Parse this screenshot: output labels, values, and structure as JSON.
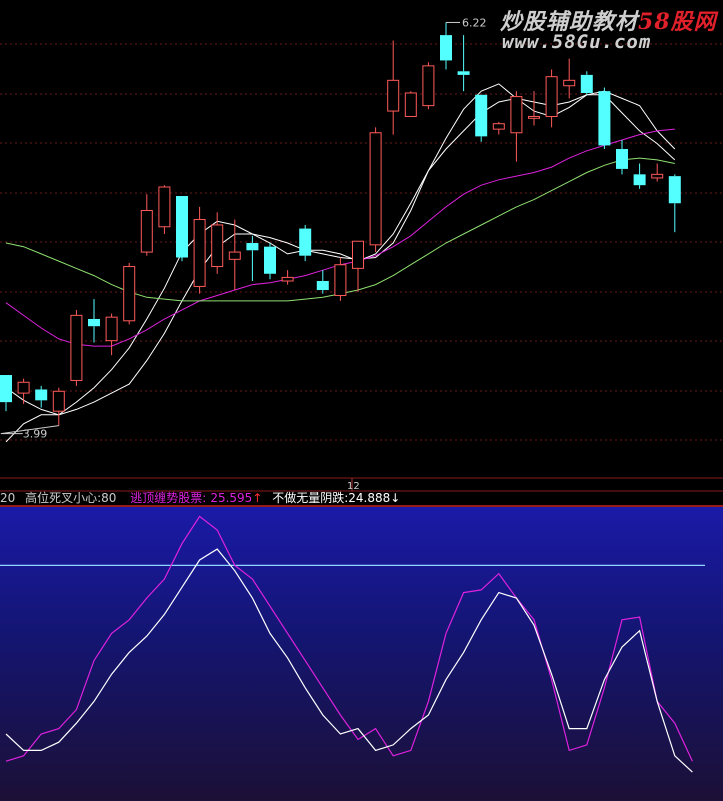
{
  "watermark": {
    "line1_a": "炒股辅助教材",
    "line1_b": "58股网",
    "line2": "www.58Gu.com"
  },
  "indicator_header": {
    "prefix": "20",
    "item1": "高位死叉小心:80",
    "item2_label": "逃顶缠势股票:",
    "item2_value": "25.595",
    "item2_arrow": "↑",
    "item3_label": "不做无量阴跌:",
    "item3_value": "24.888",
    "item3_arrow": "↓"
  },
  "chart_data": [
    {
      "type": "candlestick",
      "title": "",
      "high_label": "6.22",
      "low_label": "3.99",
      "x_tick_label": "12",
      "up_color": "#ff5a5a",
      "down_color": "#54ffff",
      "ylim": [
        3.8,
        6.3
      ],
      "candles": [
        {
          "o": 4.27,
          "h": 4.27,
          "l": 4.07,
          "c": 4.12
        },
        {
          "o": 4.17,
          "h": 4.25,
          "l": 4.11,
          "c": 4.23
        },
        {
          "o": 4.19,
          "h": 4.21,
          "l": 4.09,
          "c": 4.13
        },
        {
          "o": 4.07,
          "h": 4.2,
          "l": 3.99,
          "c": 4.18
        },
        {
          "o": 4.24,
          "h": 4.63,
          "l": 4.21,
          "c": 4.6
        },
        {
          "o": 4.58,
          "h": 4.69,
          "l": 4.45,
          "c": 4.54
        },
        {
          "o": 4.46,
          "h": 4.61,
          "l": 4.38,
          "c": 4.59
        },
        {
          "o": 4.57,
          "h": 4.89,
          "l": 4.55,
          "c": 4.87
        },
        {
          "o": 4.95,
          "h": 5.27,
          "l": 4.93,
          "c": 5.18
        },
        {
          "o": 5.09,
          "h": 5.32,
          "l": 5.05,
          "c": 5.31
        },
        {
          "o": 5.26,
          "h": 5.26,
          "l": 4.9,
          "c": 4.92
        },
        {
          "o": 4.76,
          "h": 5.2,
          "l": 4.72,
          "c": 5.13
        },
        {
          "o": 4.87,
          "h": 5.17,
          "l": 4.83,
          "c": 5.1
        },
        {
          "o": 4.91,
          "h": 5.13,
          "l": 4.74,
          "c": 4.95
        },
        {
          "o": 5.0,
          "h": 5.04,
          "l": 4.79,
          "c": 4.96
        },
        {
          "o": 4.98,
          "h": 5.0,
          "l": 4.8,
          "c": 4.83
        },
        {
          "o": 4.79,
          "h": 4.85,
          "l": 4.77,
          "c": 4.81
        },
        {
          "o": 5.08,
          "h": 5.1,
          "l": 4.9,
          "c": 4.93
        },
        {
          "o": 4.79,
          "h": 4.85,
          "l": 4.72,
          "c": 4.74
        },
        {
          "o": 4.71,
          "h": 4.92,
          "l": 4.68,
          "c": 4.88
        },
        {
          "o": 4.86,
          "h": 5.0,
          "l": 4.73,
          "c": 5.01
        },
        {
          "o": 4.99,
          "h": 5.64,
          "l": 4.95,
          "c": 5.61
        },
        {
          "o": 5.73,
          "h": 6.12,
          "l": 5.6,
          "c": 5.9
        },
        {
          "o": 5.7,
          "h": 5.84,
          "l": 5.7,
          "c": 5.83
        },
        {
          "o": 5.76,
          "h": 6.0,
          "l": 5.74,
          "c": 5.98
        },
        {
          "o": 6.15,
          "h": 6.22,
          "l": 5.96,
          "c": 6.01
        },
        {
          "o": 5.95,
          "h": 6.15,
          "l": 5.84,
          "c": 5.93
        },
        {
          "o": 5.82,
          "h": 5.82,
          "l": 5.56,
          "c": 5.59
        },
        {
          "o": 5.63,
          "h": 5.67,
          "l": 5.6,
          "c": 5.66
        },
        {
          "o": 5.61,
          "h": 5.84,
          "l": 5.45,
          "c": 5.81
        },
        {
          "o": 5.69,
          "h": 5.84,
          "l": 5.65,
          "c": 5.7
        },
        {
          "o": 5.7,
          "h": 5.96,
          "l": 5.64,
          "c": 5.92
        },
        {
          "o": 5.87,
          "h": 6.02,
          "l": 5.8,
          "c": 5.9
        },
        {
          "o": 5.93,
          "h": 5.95,
          "l": 5.82,
          "c": 5.83
        },
        {
          "o": 5.84,
          "h": 5.86,
          "l": 5.52,
          "c": 5.54
        },
        {
          "o": 5.52,
          "h": 5.57,
          "l": 5.38,
          "c": 5.41
        },
        {
          "o": 5.38,
          "h": 5.44,
          "l": 5.3,
          "c": 5.32
        },
        {
          "o": 5.36,
          "h": 5.44,
          "l": 5.34,
          "c": 5.38
        },
        {
          "o": 5.37,
          "h": 5.38,
          "l": 5.06,
          "c": 5.22
        }
      ],
      "ma_series": [
        {
          "color": "#ffffff",
          "values": [
            3.9,
            4.0,
            4.05,
            4.05,
            4.12,
            4.2,
            4.3,
            4.42,
            4.58,
            4.75,
            4.95,
            5.05,
            5.12,
            5.1,
            5.05,
            5.0,
            4.94,
            4.96,
            4.96,
            4.94,
            4.9,
            4.94,
            5.05,
            5.22,
            5.4,
            5.52,
            5.62,
            5.72,
            5.78,
            5.8,
            5.78,
            5.76,
            5.78,
            5.82,
            5.82,
            5.72,
            5.62,
            5.55,
            5.46
          ]
        },
        {
          "color": "#ffffff",
          "values": [
            4.2,
            4.13,
            4.08,
            4.05,
            4.08,
            4.12,
            4.17,
            4.22,
            4.35,
            4.5,
            4.68,
            4.85,
            4.98,
            5.05,
            5.05,
            5.03,
            5.0,
            4.96,
            4.94,
            4.92,
            4.91,
            4.92,
            5.0,
            5.18,
            5.4,
            5.58,
            5.74,
            5.84,
            5.88,
            5.8,
            5.73,
            5.7,
            5.75,
            5.82,
            5.84,
            5.8,
            5.76,
            5.62,
            5.52
          ]
        },
        {
          "color": "#dd22dd",
          "values": [
            4.67,
            4.6,
            4.53,
            4.47,
            4.44,
            4.43,
            4.43,
            4.47,
            4.52,
            4.58,
            4.63,
            4.68,
            4.71,
            4.74,
            4.77,
            4.78,
            4.8,
            4.82,
            4.85,
            4.88,
            4.9,
            4.93,
            4.98,
            5.04,
            5.12,
            5.2,
            5.27,
            5.32,
            5.35,
            5.37,
            5.39,
            5.42,
            5.47,
            5.51,
            5.54,
            5.57,
            5.6,
            5.62,
            5.63
          ]
        },
        {
          "color": "#8fe070",
          "values": [
            5.0,
            4.98,
            4.94,
            4.9,
            4.86,
            4.82,
            4.77,
            4.73,
            4.7,
            4.69,
            4.68,
            4.68,
            4.68,
            4.68,
            4.68,
            4.68,
            4.68,
            4.69,
            4.7,
            4.72,
            4.74,
            4.77,
            4.82,
            4.88,
            4.94,
            5.0,
            5.05,
            5.1,
            5.15,
            5.2,
            5.24,
            5.29,
            5.34,
            5.39,
            5.43,
            5.46,
            5.47,
            5.46,
            5.44
          ]
        }
      ]
    },
    {
      "type": "line",
      "title": "",
      "ylim": [
        0,
        100
      ],
      "reference_line": 80,
      "series": [
        {
          "name": "逃顶缠势股票",
          "color": "#dd22dd",
          "values": [
            8,
            10,
            18,
            20,
            27,
            45,
            55,
            60,
            68,
            75,
            88,
            98,
            93,
            80,
            75,
            65,
            55,
            45,
            35,
            25,
            16,
            20,
            10,
            12,
            30,
            55,
            70,
            71,
            77,
            68,
            60,
            38,
            12,
            14,
            35,
            60,
            61,
            30,
            22,
            8
          ]
        },
        {
          "name": "不做无量阴跌",
          "color": "#ffffff",
          "values": [
            18,
            12,
            12,
            15,
            22,
            30,
            40,
            48,
            54,
            62,
            72,
            82,
            86,
            78,
            68,
            55,
            46,
            35,
            25,
            18,
            20,
            12,
            14,
            20,
            25,
            38,
            48,
            60,
            70,
            68,
            58,
            40,
            20,
            20,
            38,
            50,
            56,
            30,
            10,
            4
          ]
        }
      ]
    }
  ]
}
